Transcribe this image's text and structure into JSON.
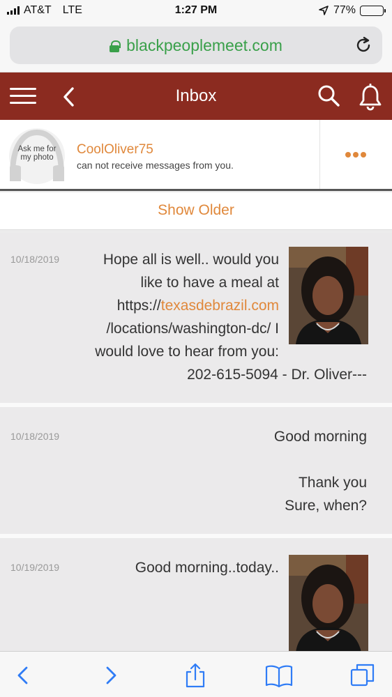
{
  "status_bar": {
    "carrier": "AT&T",
    "network": "LTE",
    "time": "1:27 PM",
    "battery": "77%",
    "battery_level": 0.77,
    "location_icon": "location-arrow-icon"
  },
  "browser": {
    "url": "blackpeoplemeet.com",
    "lock_icon": "lock-icon",
    "reload_icon": "reload-icon"
  },
  "header": {
    "title": "Inbox",
    "color": "#8b2b20",
    "icons": [
      "hamburger-menu-icon",
      "back-chevron-icon",
      "search-icon",
      "bell-icon"
    ]
  },
  "contact": {
    "avatar_text_line1": "Ask me for",
    "avatar_text_line2": "my photo",
    "name": "CoolOliver75",
    "status": "can not receive messages from you.",
    "accent_color": "#e0883b"
  },
  "show_older": "Show Older",
  "messages": [
    {
      "date": "10/18/2019",
      "line1": "Hope all is well.. would you",
      "line2": "like to have a meal at",
      "line3_prefix": "https://",
      "line3_link": "texasdebrazil.com",
      "line4": "/locations/washington-dc/ I",
      "line5": "would love to hear from you:",
      "line6": "202-615-5094 - Dr. Oliver---"
    },
    {
      "date": "10/18/2019",
      "line1": "Good morning",
      "line2": "Thank you",
      "line3": "Sure, when?"
    },
    {
      "date": "10/19/2019",
      "line1": "Good morning..today.."
    }
  ],
  "toolbar": {
    "icons": [
      "back-arrow-icon",
      "forward-arrow-icon",
      "share-icon",
      "bookmarks-icon",
      "tabs-icon"
    ]
  }
}
